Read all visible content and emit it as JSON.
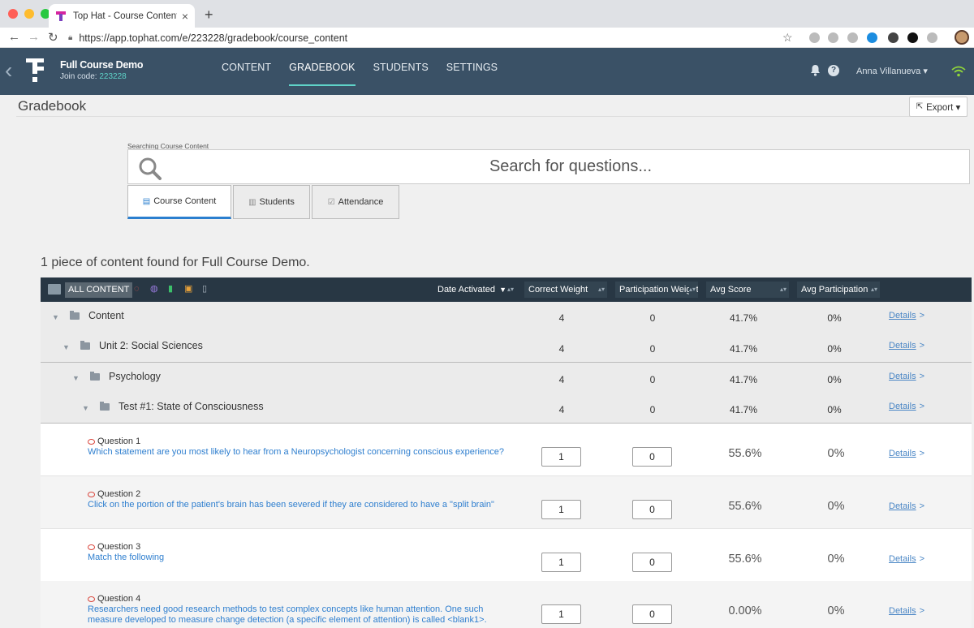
{
  "browser": {
    "tab_title": "Top Hat - Course Content Grad",
    "url": "https://app.tophat.com/e/223228/gradebook/course_content",
    "new_tab": "+",
    "close": "×"
  },
  "header": {
    "course_title": "Full Course Demo",
    "join_label": "Join code:",
    "join_code": "223228",
    "nav": [
      "CONTENT",
      "GRADEBOOK",
      "STUDENTS",
      "SETTINGS"
    ],
    "active_nav": "GRADEBOOK",
    "help": "?",
    "user": "Anna Villanueva ▾"
  },
  "page": {
    "title": "Gradebook",
    "export_label": "Export ▾"
  },
  "search": {
    "label": "Searching Course Content",
    "placeholder": "Search for questions..."
  },
  "search_tabs": [
    {
      "label": "Course Content",
      "icon": "document-icon"
    },
    {
      "label": "Students",
      "icon": "student-icon"
    },
    {
      "label": "Attendance",
      "icon": "checkbox-icon"
    }
  ],
  "results_text": "1 piece of content found for Full Course Demo.",
  "table": {
    "all_content": "ALL CONTENT",
    "columns": [
      "Date Activated",
      "Correct Weight",
      "Participation Weight",
      "Avg Score",
      "Avg Participation"
    ],
    "details_label": "Details",
    "details_arrow": ">",
    "groups": [
      {
        "name": "Content",
        "correct": "4",
        "participation": "0",
        "avg_score": "41.7%",
        "avg_participation": "0%"
      },
      {
        "name": "Unit 2: Social Sciences",
        "correct": "4",
        "participation": "0",
        "avg_score": "41.7%",
        "avg_participation": "0%"
      },
      {
        "name": "Psychology",
        "correct": "4",
        "participation": "0",
        "avg_score": "41.7%",
        "avg_participation": "0%"
      },
      {
        "name": "Test #1: State of Consciousness",
        "correct": "4",
        "participation": "0",
        "avg_score": "41.7%",
        "avg_participation": "0%"
      }
    ],
    "questions": [
      {
        "label": "Question 1",
        "text": "Which statement are you most likely to hear from a Neuropsychologist concerning conscious experience?",
        "correct": "1",
        "participation": "0",
        "avg_score": "55.6%",
        "avg_participation": "0%"
      },
      {
        "label": "Question 2",
        "text": "Click on the portion of the patient's brain has been severed if they are considered to have a \"split brain\"",
        "correct": "1",
        "participation": "0",
        "avg_score": "55.6%",
        "avg_participation": "0%"
      },
      {
        "label": "Question 3",
        "text": "Match the following",
        "correct": "1",
        "participation": "0",
        "avg_score": "55.6%",
        "avg_participation": "0%"
      },
      {
        "label": "Question 4",
        "text": "Researchers need good research methods to test complex concepts like human attention. One such measure developed to measure change detection (a specific element of attention) is called <blank1>.",
        "correct": "1",
        "participation": "0",
        "avg_score": "0.00%",
        "avg_participation": "0%"
      }
    ]
  },
  "colors": {
    "appbar": "#3a5166",
    "accent": "#5fd3c8",
    "link": "#2f7fcf",
    "table_header": "#283744"
  }
}
